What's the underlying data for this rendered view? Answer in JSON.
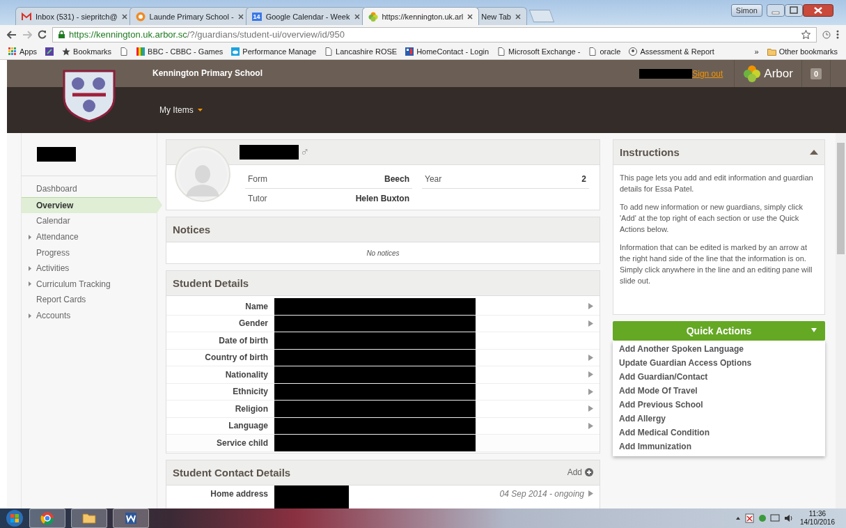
{
  "browser": {
    "tabs": [
      {
        "kind": "mail",
        "title": "Inbox (531) - siepritch@",
        "selected": false
      },
      {
        "kind": "circle",
        "title": "Launde Primary School -",
        "selected": false
      },
      {
        "kind": "calendar",
        "icon_label": "14",
        "title": "Google Calendar - Week",
        "selected": false
      },
      {
        "kind": "arbor",
        "title": "https://kennington.uk.arl",
        "selected": true
      },
      {
        "kind": "blank",
        "title": "New Tab",
        "selected": false
      }
    ],
    "profile": "Simon",
    "url_host": "https://kennington.uk.arbor.sc",
    "url_path": "/?/guardians/student-ui/overview/id/950",
    "bookmarks": [
      {
        "kind": "apps",
        "label": "Apps"
      },
      {
        "kind": "square"
      },
      {
        "kind": "star",
        "label": "Bookmarks"
      },
      {
        "kind": "page"
      },
      {
        "kind": "bars",
        "label": "BBC - CBBC - Games"
      },
      {
        "kind": "cloud",
        "label": "Performance Manage"
      },
      {
        "kind": "page",
        "label": "Lancashire ROSE"
      },
      {
        "kind": "grid",
        "label": "HomeContact - Login"
      },
      {
        "kind": "page",
        "label": "Microsoft Exchange -"
      },
      {
        "kind": "page",
        "label": "oracle"
      },
      {
        "kind": "badge",
        "label": "Assessment & Report"
      }
    ],
    "overflow": "»",
    "other_bookmarks": "Other bookmarks"
  },
  "header": {
    "school": "Kennington Primary School",
    "menu": "My Items",
    "sign_out": "Sign out",
    "brand": "Arbor",
    "notifications": "0"
  },
  "sidebar": {
    "items": [
      {
        "label": "Dashboard",
        "selected": false,
        "expandable": false
      },
      {
        "label": "Overview",
        "selected": true,
        "expandable": false
      },
      {
        "label": "Calendar",
        "selected": false,
        "expandable": false
      },
      {
        "label": "Attendance",
        "selected": false,
        "expandable": true
      },
      {
        "label": "Progress",
        "selected": false,
        "expandable": false
      },
      {
        "label": "Activities",
        "selected": false,
        "expandable": true
      },
      {
        "label": "Curriculum Tracking",
        "selected": false,
        "expandable": true
      },
      {
        "label": "Report Cards",
        "selected": false,
        "expandable": false
      },
      {
        "label": "Accounts",
        "selected": false,
        "expandable": true
      }
    ]
  },
  "student": {
    "gender_symbol": "♂",
    "fields": [
      {
        "label": "Form",
        "value": "Beech"
      },
      {
        "label": "Year",
        "value": "2"
      },
      {
        "label": "Tutor",
        "value": "Helen Buxton"
      }
    ]
  },
  "notices": {
    "title": "Notices",
    "empty": "No notices"
  },
  "student_details": {
    "title": "Student Details",
    "rows": [
      {
        "label": "Name",
        "editable": true
      },
      {
        "label": "Gender",
        "editable": true
      },
      {
        "label": "Date of birth",
        "editable": false
      },
      {
        "label": "Country of birth",
        "editable": true
      },
      {
        "label": "Nationality",
        "editable": true
      },
      {
        "label": "Ethnicity",
        "editable": true
      },
      {
        "label": "Religion",
        "editable": true
      },
      {
        "label": "Language",
        "editable": true
      },
      {
        "label": "Service child",
        "editable": false
      }
    ]
  },
  "contact_details": {
    "title": "Student Contact Details",
    "add": "Add",
    "rows": [
      {
        "label": "Home address",
        "period": "04 Sep 2014 - ongoing",
        "editable": true
      }
    ]
  },
  "instructions": {
    "title": "Instructions",
    "expanded": true,
    "paragraphs": [
      "This page lets you add and edit information and guardian details for Essa Patel.",
      "To add new information or new guardians, simply click 'Add' at the top right of each section or use the Quick Actions below.",
      "Information that can be edited is marked by an arrow at the right hand side of the line that the information is on. Simply click anywhere in the line and an editing pane will slide out."
    ]
  },
  "quick_actions": {
    "title": "Quick Actions",
    "expanded": true,
    "items": [
      "Add Another Spoken Language",
      "Update Guardian Access Options",
      "Add Guardian/Contact",
      "Add Mode Of Travel",
      "Add Previous School",
      "Add Allergy",
      "Add Medical Condition",
      "Add Immunization"
    ]
  },
  "taskbar": {
    "time": "11:36",
    "date": "14/10/2016"
  }
}
